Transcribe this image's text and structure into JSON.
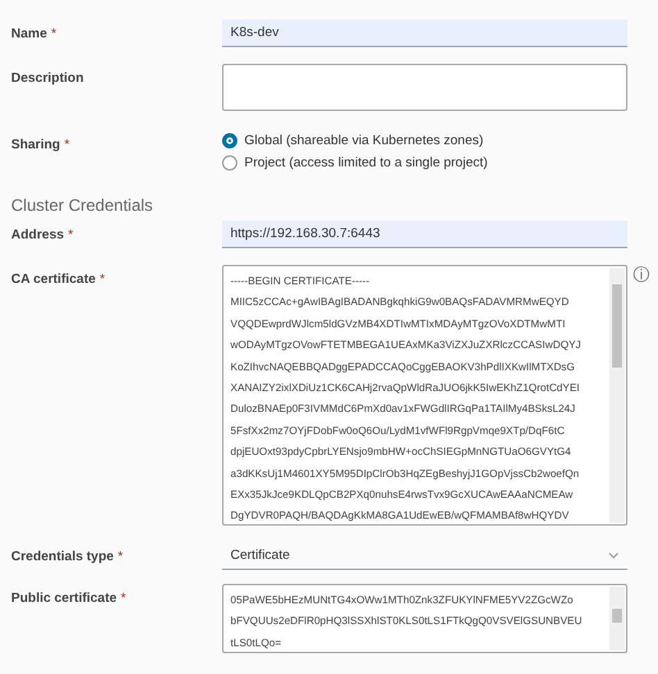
{
  "fields": [
    {
      "kind": "text",
      "label": "Name",
      "required_mark": "*",
      "value": "K8s-dev"
    },
    {
      "kind": "textarea",
      "label": "Description"
    },
    {
      "kind": "radio",
      "label": "Sharing",
      "required_mark": "*",
      "options": [
        {
          "label": "Global (shareable via Kubernetes zones)",
          "selected": true
        },
        {
          "label": "Project (access limited to a single project)",
          "selected": false
        }
      ]
    },
    {
      "kind": "heading",
      "label": "Cluster Credentials"
    },
    {
      "kind": "text",
      "label": "Address",
      "required_mark": "*",
      "value": "https://192.168.30.7:6443"
    },
    {
      "kind": "certificate",
      "label": "CA certificate",
      "required_mark": "*",
      "info": "ⓘ",
      "lines": [
        "-----BEGIN CERTIFICATE-----",
        "MIIC5zCCAc+gAwIBAgIBADANBgkqhkiG9w0BAQsFADAVMRMwEQYD",
        "VQQDEwprdWJlcm5ldGVzMB4XDTIwMTIxMDAyMTgzOVoXDTMwMTI",
        "wODAyMTgzOVowFTETMBEGA1UEAxMKa3ViZXJuZXRlczCCASIwDQYJ",
        "KoZIhvcNAQEBBQADggEPADCCAQoCggEBAOKV3hPdlIXKwIlMTXDsG",
        "XANAIZY2ixlXDiUz1CK6CAHj2rvaQpWldRaJUO6jkK5IwEKhZ1QrotCdYEI",
        "DulozBNAEp0F3IVMMdC6PmXd0av1xFWGdlIRGqPa1TAIlMy4BSksL24J",
        "5FsfXx2mz7OYjFDobFw0oQ6Ou/LydM1vfWFl9RgpVmqe9XTp/DqF6tC",
        "dpjEUOxt93pdyCpbrLYENsjo9mbHW+ocChSIEGpMnNGTUaO6GVYtG4",
        "a3dKKsUj1M4601XY5M95DIpClrOb3HqZEgBeshyjJ1GOpVjssCb2woefQn",
        "EXx35JkJce9KDLQpCB2PXq0nuhsE4rwsTvx9GcXUCAwEAAaNCMEAw",
        "DgYDVR0PAQH/BAQDAgKkMA8GA1UdEwEB/wQFMAMBAf8wHQYDV"
      ]
    },
    {
      "kind": "select",
      "label": "Credentials type",
      "required_mark": "*",
      "value": "Certificate"
    },
    {
      "kind": "public-certificate",
      "label": "Public certificate",
      "required_mark": "*",
      "lines": [
        "05PaWE5bHEzMUNtTG4xOWw1MTh0Znk3ZFUKYlNFME5YV2ZGcWZo",
        "bFVQUUs2eDFlR0pHQ3lSSXhlST0KLS0tLS1FTkQgQ0VSVElGSUNBVEU",
        "tLS0tLQo="
      ]
    }
  ]
}
